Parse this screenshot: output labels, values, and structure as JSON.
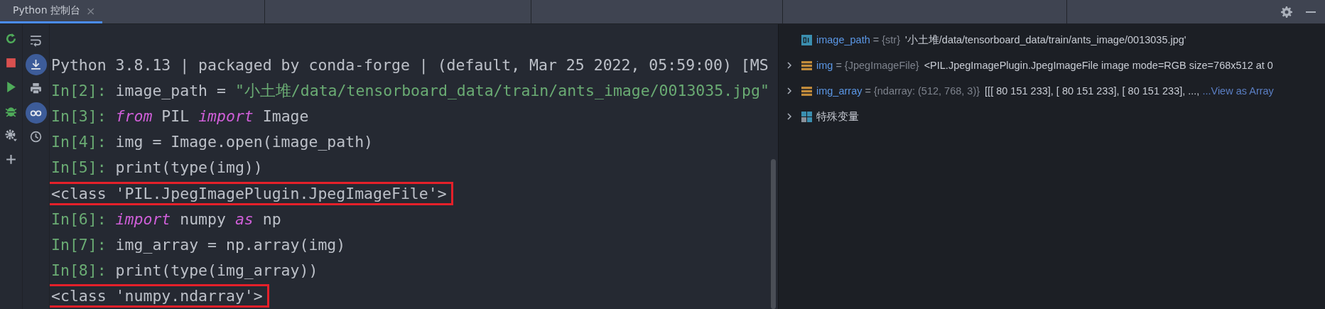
{
  "tabs": [
    {
      "label": "Python 控制台",
      "close": "×",
      "selected": true
    }
  ],
  "toolbar_primary": [
    {
      "kind": "rerun"
    },
    {
      "kind": "stop"
    },
    {
      "kind": "run"
    },
    {
      "kind": "debug"
    },
    {
      "kind": "settings"
    },
    {
      "kind": "add"
    }
  ],
  "toolbar_secondary": [
    {
      "kind": "wrap",
      "on": false
    },
    {
      "kind": "scroll-end",
      "on": true
    },
    {
      "kind": "print",
      "on": false
    },
    {
      "kind": "glasses",
      "on": true
    },
    {
      "kind": "history",
      "on": false
    }
  ],
  "console_lines": [
    {
      "annotated": false,
      "segments": [
        {
          "kind": "plain",
          "text": "Python 3.8.13 | packaged by conda-forge | (default, Mar 25 2022, 05:59:00) [MS"
        }
      ]
    },
    {
      "annotated": false,
      "segments": [
        {
          "kind": "prompt",
          "text": "In[2]: "
        },
        {
          "kind": "plain",
          "text": "image_path = "
        },
        {
          "kind": "string",
          "text": "\"小土堆/data/tensorboard_data/train/ants_image/0013035.jpg\""
        }
      ]
    },
    {
      "annotated": false,
      "segments": [
        {
          "kind": "prompt",
          "text": "In[3]: "
        },
        {
          "kind": "keyword",
          "text": "from"
        },
        {
          "kind": "plain",
          "text": " PIL "
        },
        {
          "kind": "keyword",
          "text": "import"
        },
        {
          "kind": "plain",
          "text": " Image"
        }
      ]
    },
    {
      "annotated": false,
      "segments": [
        {
          "kind": "prompt",
          "text": "In[4]: "
        },
        {
          "kind": "plain",
          "text": "img = Image.open(image_path)"
        }
      ]
    },
    {
      "annotated": false,
      "segments": [
        {
          "kind": "prompt",
          "text": "In[5]: "
        },
        {
          "kind": "plain",
          "text": "print(type(img))"
        }
      ]
    },
    {
      "annotated": true,
      "segments": [
        {
          "kind": "plain",
          "text": "<class 'PIL.JpegImagePlugin.JpegImageFile'>"
        }
      ]
    },
    {
      "annotated": false,
      "segments": [
        {
          "kind": "prompt",
          "text": "In[6]: "
        },
        {
          "kind": "keyword",
          "text": "import"
        },
        {
          "kind": "plain",
          "text": " numpy "
        },
        {
          "kind": "keyword",
          "text": "as"
        },
        {
          "kind": "plain",
          "text": " np"
        }
      ]
    },
    {
      "annotated": false,
      "segments": [
        {
          "kind": "prompt",
          "text": "In[7]: "
        },
        {
          "kind": "plain",
          "text": "img_array = np.array(img)"
        }
      ]
    },
    {
      "annotated": false,
      "segments": [
        {
          "kind": "prompt",
          "text": "In[8]: "
        },
        {
          "kind": "plain",
          "text": "print(type(img_array))"
        }
      ]
    },
    {
      "annotated": true,
      "segments": [
        {
          "kind": "plain",
          "text": "<class 'numpy.ndarray'>"
        }
      ]
    }
  ],
  "variables": [
    {
      "kind": "str",
      "name": "image_path",
      "equals": "=",
      "type": "{str}",
      "value": "'小土堆/data/tensorboard_data/train/ants_image/0013035.jpg'"
    },
    {
      "kind": "object",
      "expanded": false,
      "name": "img",
      "equals": "=",
      "type": "{JpegImageFile}",
      "value": "<PIL.JpegImagePlugin.JpegImageFile image mode=RGB size=768x512 at 0"
    },
    {
      "kind": "object",
      "expanded": false,
      "name": "img_array",
      "equals": "=",
      "type": "{ndarray: (512, 768, 3)}",
      "value": "[[[ 80 151 233],  [ 80 151 233],  [ 80 151 233],  ...,",
      "link": "...View as Array"
    },
    {
      "kind": "special",
      "expanded": false,
      "label": "特殊变量"
    }
  ]
}
